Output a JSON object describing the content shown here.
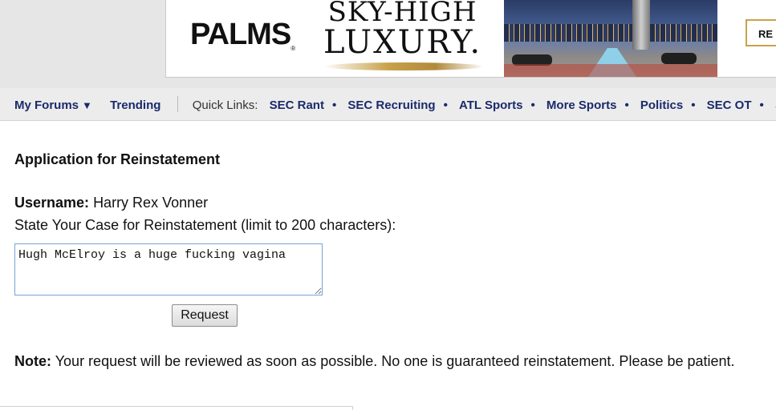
{
  "ad": {
    "brand": "PALMS",
    "brand_mark": "®",
    "headline_line1": "SKY-HIGH",
    "headline_line2": "LUXURY.",
    "cta_label": "RE",
    "accent_color": "#c9a14a"
  },
  "nav": {
    "my_forums": "My Forums",
    "my_forums_caret": "▼",
    "trending": "Trending",
    "quick_links_label": "Quick Links:",
    "quick_links": [
      "SEC Rant",
      "SEC Recruiting",
      "ATL Sports",
      "More Sports",
      "Politics",
      "SEC OT",
      "SE"
    ],
    "link_color": "#1a2a6b"
  },
  "form": {
    "title": "Application for Reinstatement",
    "username_label": "Username:",
    "username_value": "Harry Rex Vonner",
    "case_prompt": "State Your Case for Reinstatement (limit to 200 characters):",
    "case_value": "Hugh McElroy is a huge fucking vagina ",
    "request_button": "Request",
    "note_label": "Note:",
    "note_text": "Your request will be reviewed as soon as possible. No one is guaranteed reinstatement. Please be patient."
  }
}
